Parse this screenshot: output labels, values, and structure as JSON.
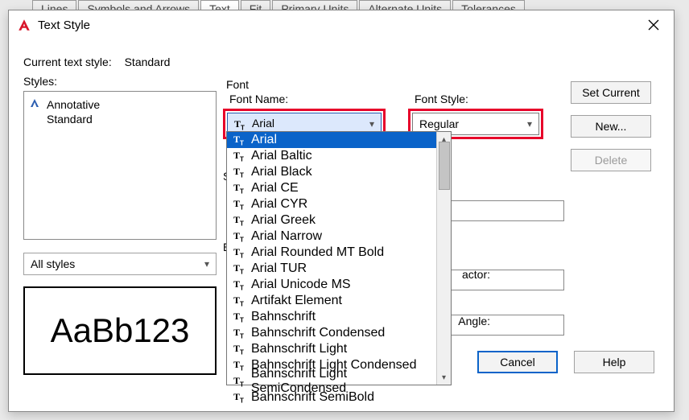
{
  "bg_tabs": [
    "Lines",
    "Symbols and Arrows",
    "Text",
    "Fit",
    "Primary Units",
    "Alternate Units",
    "Tolerances"
  ],
  "bg_active_tab_index": 2,
  "dialog": {
    "title": "Text Style"
  },
  "current": {
    "label": "Current text style:",
    "value": "Standard"
  },
  "styles": {
    "label": "Styles:",
    "items": [
      {
        "name": "Annotative",
        "icon": "annot"
      },
      {
        "name": "Standard",
        "icon": ""
      }
    ],
    "filter_options": [
      "All styles"
    ],
    "preview_text": "AaBb123"
  },
  "font": {
    "group_label": "Font",
    "name_label": "Font Name:",
    "name_value": "Arial",
    "style_label": "Font Style:",
    "style_value": "Regular",
    "dropdown": [
      "Arial",
      "Arial Baltic",
      "Arial Black",
      "Arial CE",
      "Arial CYR",
      "Arial Greek",
      "Arial Narrow",
      "Arial Rounded MT Bold",
      "Arial TUR",
      "Arial Unicode MS",
      "Artifakt Element",
      "Bahnschrift",
      "Bahnschrift Condensed",
      "Bahnschrift Light",
      "Bahnschrift Light Condensed",
      "Bahnschrift Light SemiCondensed",
      "Bahnschrift SemiBold"
    ],
    "dropdown_selected_index": 0
  },
  "partials": {
    "s1": "S",
    "s2": "E"
  },
  "mid_labels": {
    "factor": "actor:",
    "angle": "Angle:"
  },
  "buttons": {
    "set_current": "Set Current",
    "new": "New...",
    "delete": "Delete",
    "cancel": "Cancel",
    "help": "Help"
  }
}
